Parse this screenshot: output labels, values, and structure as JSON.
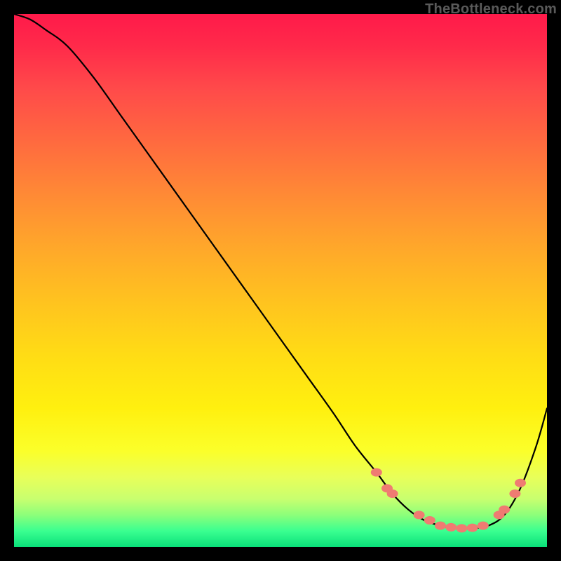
{
  "watermark": "TheBottleneck.com",
  "colors": {
    "curve": "#000000",
    "marker_fill": "#ef7b72",
    "marker_stroke": "#e06058"
  },
  "chart_data": {
    "type": "line",
    "title": "",
    "xlabel": "",
    "ylabel": "",
    "xlim": [
      0,
      100
    ],
    "ylim": [
      0,
      100
    ],
    "grid": false,
    "legend": false,
    "series": [
      {
        "name": "bottleneck-curve",
        "x": [
          0,
          3,
          6,
          10,
          15,
          20,
          25,
          30,
          35,
          40,
          45,
          50,
          55,
          60,
          64,
          68,
          71,
          74,
          77,
          80,
          83,
          86,
          89,
          92,
          95,
          98,
          100
        ],
        "values": [
          100,
          99,
          97,
          94,
          88,
          81,
          74,
          67,
          60,
          53,
          46,
          39,
          32,
          25,
          19,
          14,
          10,
          7,
          5,
          4,
          3.5,
          3.5,
          4,
          6,
          11,
          19,
          26
        ]
      }
    ],
    "markers": {
      "comment": "salmon blob markers near the trough of the curve",
      "points": [
        {
          "x": 68,
          "y": 14
        },
        {
          "x": 70,
          "y": 11
        },
        {
          "x": 71,
          "y": 10
        },
        {
          "x": 76,
          "y": 6
        },
        {
          "x": 78,
          "y": 5
        },
        {
          "x": 80,
          "y": 4
        },
        {
          "x": 82,
          "y": 3.7
        },
        {
          "x": 84,
          "y": 3.5
        },
        {
          "x": 86,
          "y": 3.6
        },
        {
          "x": 88,
          "y": 4
        },
        {
          "x": 91,
          "y": 6
        },
        {
          "x": 92,
          "y": 7
        },
        {
          "x": 94,
          "y": 10
        },
        {
          "x": 95,
          "y": 12
        }
      ]
    }
  }
}
